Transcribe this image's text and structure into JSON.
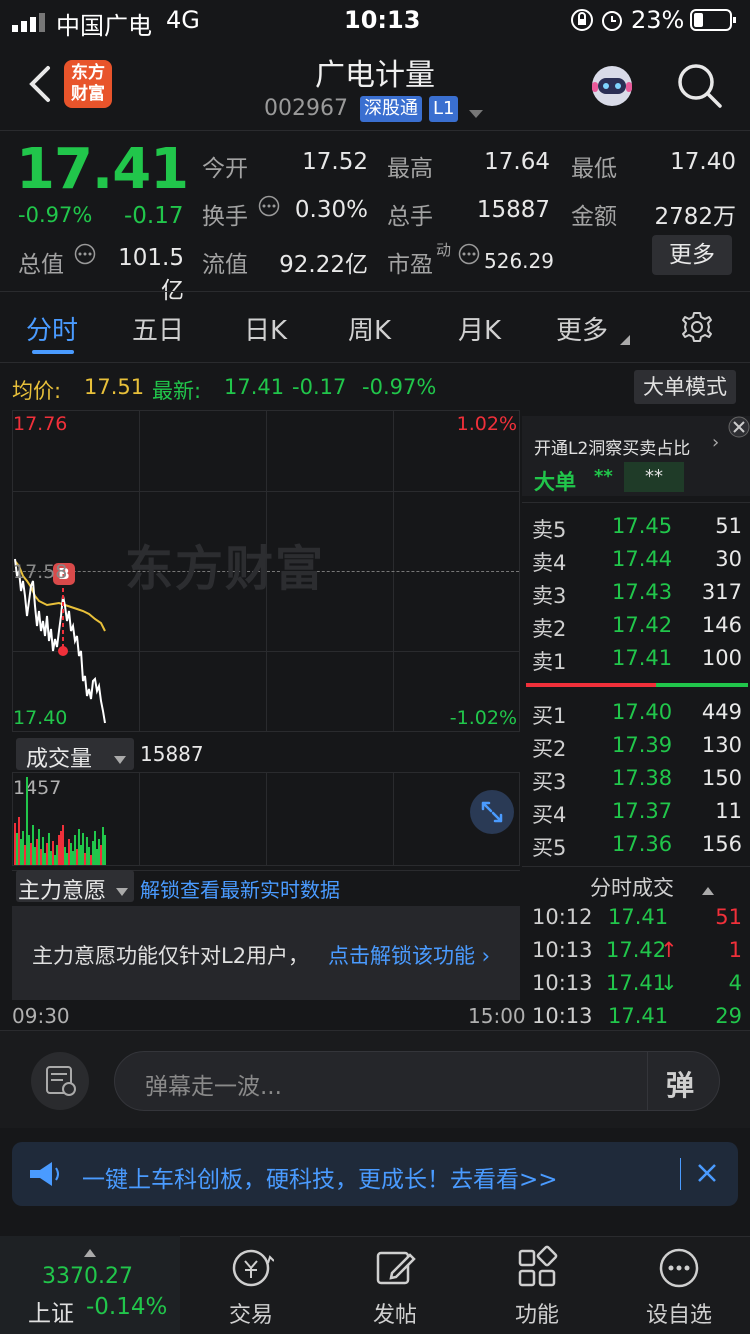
{
  "status_bar": {
    "carrier": "中国广电",
    "network": "4G",
    "time": "10:13",
    "battery": "23%"
  },
  "header": {
    "logo_text_line1": "东方",
    "logo_text_line2": "财富",
    "title": "广电计量",
    "code": "002967",
    "badge_connect": "深股通",
    "badge_level": "L1"
  },
  "quote": {
    "price": "17.41",
    "change_pct": "-0.97%",
    "change": "-0.17",
    "open_label": "今开",
    "open": "17.52",
    "high_label": "最高",
    "high": "17.64",
    "low_label": "最低",
    "low": "17.40",
    "turnover_label": "换手",
    "turnover": "0.30%",
    "volume_label": "总手",
    "volume": "15887",
    "amount_label": "金额",
    "amount": "2782万",
    "mktcap_label": "总值",
    "mktcap": "101.5亿",
    "float_label": "流值",
    "float_cap": "92.22亿",
    "pe_label": "市盈",
    "pe_sup": "动",
    "pe": "526.29",
    "more_button": "更多"
  },
  "tabs": [
    "分时",
    "五日",
    "日K",
    "周K",
    "月K",
    "更多"
  ],
  "info_line": {
    "avg_label": "均价:",
    "avg": "17.51",
    "latest_label": "最新:",
    "latest": "17.41",
    "chg": "-0.17",
    "chg_pct": "-0.97%",
    "big_order_button": "大单模式"
  },
  "chart": {
    "y_high": "17.76",
    "y_low": "17.40",
    "pct_high": "1.02%",
    "pct_low": "-1.02%",
    "mid_label": "17.58",
    "watermark": "东方财富",
    "marker": "B",
    "volume_dropdown": "成交量",
    "volume_total": "15887",
    "volume_max": "1457",
    "intent_dropdown": "主力意愿",
    "intent_link": "解锁查看最新实时数据",
    "intent_notice": "主力意愿功能仅针对L2用户，",
    "intent_unlock": "点击解锁该功能",
    "time_start": "09:30",
    "time_end": "15:00"
  },
  "order_book": {
    "l2_banner": "开通L2洞察买卖占比",
    "big_label": "大单",
    "big_val1": "**",
    "big_val2": "**",
    "asks": [
      {
        "label": "卖5",
        "price": "17.45",
        "vol": "51"
      },
      {
        "label": "卖4",
        "price": "17.44",
        "vol": "30"
      },
      {
        "label": "卖3",
        "price": "17.43",
        "vol": "317"
      },
      {
        "label": "卖2",
        "price": "17.42",
        "vol": "146"
      },
      {
        "label": "卖1",
        "price": "17.41",
        "vol": "100"
      }
    ],
    "bids": [
      {
        "label": "买1",
        "price": "17.40",
        "vol": "449"
      },
      {
        "label": "买2",
        "price": "17.39",
        "vol": "130"
      },
      {
        "label": "买3",
        "price": "17.38",
        "vol": "150"
      },
      {
        "label": "买4",
        "price": "17.37",
        "vol": "11"
      },
      {
        "label": "买5",
        "price": "17.36",
        "vol": "156"
      }
    ],
    "ticks_header": "分时成交",
    "ticks": [
      {
        "time": "10:12",
        "price": "17.41",
        "arrow": "",
        "vol": "51"
      },
      {
        "time": "10:13",
        "price": "17.42",
        "arrow": "↑",
        "vol": "1"
      },
      {
        "time": "10:13",
        "price": "17.41",
        "arrow": "↓",
        "vol": "4"
      },
      {
        "time": "10:13",
        "price": "17.41",
        "arrow": "",
        "vol": "29"
      }
    ]
  },
  "danmaku": {
    "placeholder": "弹幕走一波...",
    "button": "弹"
  },
  "promo": {
    "text": "一键上车科创板，硬科技，更成长！去看看>>"
  },
  "bottom_nav": {
    "index_value": "3370.27",
    "index_name": "上证",
    "index_change": "-0.14%",
    "items": [
      "交易",
      "发帖",
      "功能",
      "设自选"
    ]
  },
  "colors": {
    "up": "#f0303a",
    "down": "#21c64b",
    "accent": "#4a9bff",
    "background": "#161719"
  }
}
